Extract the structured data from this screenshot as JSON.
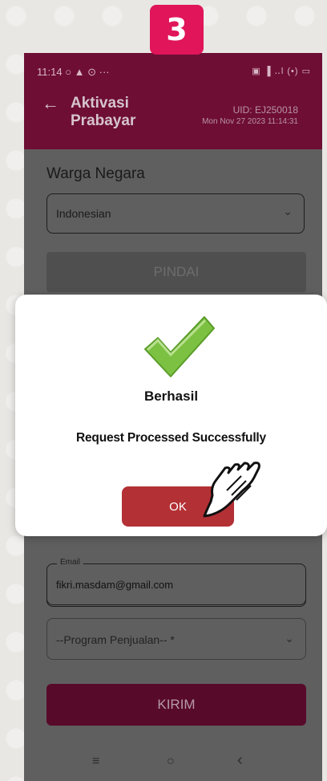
{
  "step_badge": "3",
  "status_bar": {
    "time": "11:14",
    "left_icons": "○ ▲ ⊙ ···",
    "right_icons": "▣ ▐ ‥l (•) ▭"
  },
  "app_bar": {
    "title": "Aktivasi Prabayar",
    "uid": "UID: EJ250018",
    "timestamp": "Mon Nov 27 2023 11:14:31"
  },
  "form": {
    "warga_negara_label": "Warga Negara",
    "warga_negara_value": "Indonesian",
    "pindai_button": "PINDAI",
    "email_label": "Email",
    "email_value": "fikri.masdam@gmail.com",
    "program_placeholder": "--Program Penjualan-- *",
    "kirim_button": "KIRIM"
  },
  "dialog": {
    "title": "Berhasil",
    "message": "Request Processed Successfully",
    "ok_button": "OK"
  },
  "nav": {
    "menu": "≡",
    "home": "○",
    "back": "‹"
  },
  "colors": {
    "primary": "#6e0e35",
    "kirim": "#580a2b",
    "ok_button": "#b33034",
    "badge": "#e0155a",
    "check": "#7cc142"
  }
}
